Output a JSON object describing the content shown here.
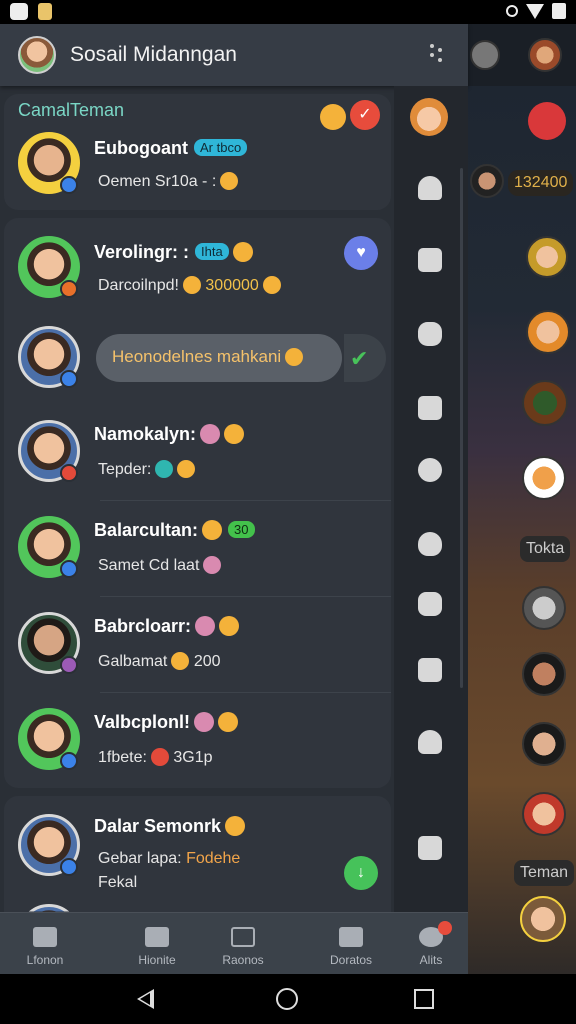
{
  "app": {
    "title": "Sosail Midanngan"
  },
  "group": {
    "header": "CamalTeman"
  },
  "contacts": [
    {
      "name": "Eubogoant",
      "tag": "Ar tbco",
      "sub": "Oemen  Sr10a - :"
    },
    {
      "name": "Verolingr: :",
      "tag": "Ihta",
      "sub": "Darcoilnpd!",
      "sub_value": "300000"
    },
    {
      "bubble": "Heonodelnes mahkani"
    },
    {
      "name": "Namokalyn:",
      "sub": "Tepder:"
    },
    {
      "name": "Balarcultan:",
      "tag": "30",
      "sub": "Samet Cd laat"
    },
    {
      "name": "Babrcloarr:",
      "sub": "Galbamat",
      "sub_value": "200"
    },
    {
      "name": "Valbcplonl!",
      "sub": "1fbete:",
      "sub_value": "3G1p"
    },
    {
      "name": "Dalar Semonrk",
      "sub": "Gebar lapa:",
      "sub_orange": "Fodehe",
      "sub2": "Fekal"
    }
  ],
  "bottom_nav": [
    {
      "label": "Lfonon"
    },
    {
      "label": "Hionite"
    },
    {
      "label": "Raonos"
    },
    {
      "label": "Doratos"
    },
    {
      "label": "Alits"
    }
  ],
  "background_app": {
    "chip1": "132400",
    "chip2": "Tokta",
    "chip3": "Teman"
  },
  "colors": {
    "drawer_bg": "#2a2f36",
    "card_bg": "#30353d",
    "header_bg": "#363c45",
    "accent_teal": "#7ad6c5",
    "badge_red": "#e74c3c",
    "badge_blue": "#3b82e8",
    "chip_blue": "#2fb6d8",
    "chip_green": "#43c14b"
  },
  "icons": {
    "status_left": [
      "camera-icon",
      "notification-icon"
    ],
    "status_right": [
      "ring-icon",
      "wifi-icon",
      "battery-icon"
    ],
    "rail": [
      "avatar-icon",
      "person-icon",
      "bookmark-icon",
      "settings-icon",
      "inbox-icon",
      "location-icon",
      "heart-icon",
      "lock-icon",
      "trash-icon",
      "bell-icon",
      "box-icon"
    ],
    "bottom_nav": [
      "home-icon",
      "games-icon",
      "rooms-icon",
      "discover-icon",
      "chat-icon"
    ]
  }
}
